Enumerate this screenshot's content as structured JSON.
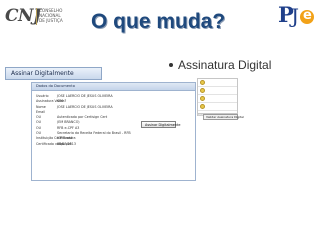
{
  "logos": {
    "cnj_mark": "CNJ",
    "cnj_text": [
      "CONSELHO",
      "NACIONAL",
      "DE JUSTIÇA"
    ],
    "pje_mark": "PJe"
  },
  "slide": {
    "title": "O que muda?",
    "bullet": "Assinatura Digital"
  },
  "screenshot": {
    "tab_label": "Assinar Digitalmente",
    "list_panel": {
      "item_count": 4,
      "footer_text": "Configurar Filtro avançado",
      "button_label": "Validar Assinatura Digital"
    },
    "doc_window": {
      "header": "Dados do Documento",
      "rows": [
        {
          "label": "Usuário",
          "value": "JOSE LAERCIO DE JESUS OLIVEIRA"
        },
        {
          "label": "Assinatura Valida?",
          "value": "SIM"
        },
        {
          "label": "Nome",
          "value": "JOSE LAERCIO DE JESUS OLIVEIRA"
        },
        {
          "label": "Email",
          "value": ""
        },
        {
          "label": "OU",
          "value": "Autenticado por Certisign Cert"
        },
        {
          "label": "OU",
          "value": "(EM BRANCO)"
        },
        {
          "label": "OU",
          "value": "RFB e-CPF A3"
        },
        {
          "label": "OU",
          "value": "Secretaria da Receita Federal do Brasil - RFB"
        },
        {
          "label": "Instituição Certificadora",
          "value": "ICP-Brasil"
        },
        {
          "label": "Certificado válido até",
          "value": "08/03/2013"
        }
      ],
      "sign_button_label": "Assinar Digitalmente"
    }
  },
  "colors": {
    "title": "#1f497d",
    "pje_blue": "#1f3f8a",
    "pje_orange": "#f2a218",
    "window_border": "#9fb3cf"
  }
}
